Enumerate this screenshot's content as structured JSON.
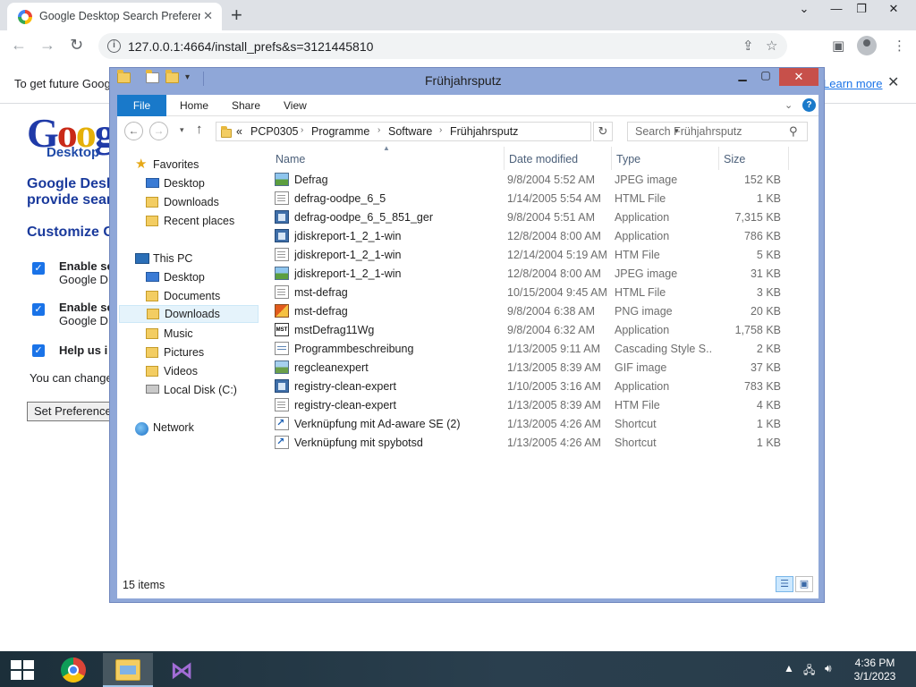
{
  "browser": {
    "tab_title": "Google Desktop Search Preferences",
    "tab_close": "✕",
    "new_tab": "+",
    "win_min": "⌄",
    "win_restore": "—",
    "win_max": "❐",
    "win_close": "✕",
    "url": "127.0.0.1:4664/install_prefs&s=3121445810",
    "info_text": "To get future Goog",
    "learn_more": "Learn more",
    "info_close": "✕",
    "icons": [
      "back-icon",
      "forward-icon",
      "reload-icon",
      "info-icon",
      "share-icon",
      "star-icon",
      "side-panel-icon",
      "profile-icon",
      "menu-icon"
    ]
  },
  "page": {
    "logo_letters": [
      "G",
      "o",
      "o",
      "g"
    ],
    "logo_sub": "Desktop",
    "heading1_line1": "Google Desk",
    "heading1_line2": "provide sear",
    "heading2": "Customize G",
    "options": [
      {
        "title": "Enable se",
        "sub": "Google D"
      },
      {
        "title": "Enable se",
        "sub": "Google D"
      },
      {
        "title": "Help us i",
        "sub": ""
      }
    ],
    "note": "You can change",
    "set_button": "Set Preferences"
  },
  "explorer": {
    "title": "Frühjahrsputz",
    "ribbon_tabs": [
      "File",
      "Home",
      "Share",
      "View"
    ],
    "breadcrumb": [
      "PCP0305",
      "Programme",
      "Software",
      "Frühjahrsputz"
    ],
    "breadcrumb_prefix": "«",
    "search_placeholder": "Search Frühjahrsputz",
    "nav": {
      "favorites": "Favorites",
      "fav_items": [
        "Desktop",
        "Downloads",
        "Recent places"
      ],
      "this_pc": "This PC",
      "pc_items": [
        "Desktop",
        "Documents",
        "Downloads",
        "Music",
        "Pictures",
        "Videos",
        "Local Disk (C:)"
      ],
      "network": "Network"
    },
    "columns": [
      "Name",
      "Date modified",
      "Type",
      "Size"
    ],
    "files": [
      {
        "name": "Defrag",
        "date": "9/8/2004 5:52 AM",
        "type": "JPEG image",
        "size": "152 KB",
        "icon": "jpeg"
      },
      {
        "name": "defrag-oodpe_6_5",
        "date": "1/14/2005 5:54 AM",
        "type": "HTML File",
        "size": "1 KB",
        "icon": "html"
      },
      {
        "name": "defrag-oodpe_6_5_851_ger",
        "date": "9/8/2004 5:51 AM",
        "type": "Application",
        "size": "7,315 KB",
        "icon": "app"
      },
      {
        "name": "jdiskreport-1_2_1-win",
        "date": "12/8/2004 8:00 AM",
        "type": "Application",
        "size": "786 KB",
        "icon": "app"
      },
      {
        "name": "jdiskreport-1_2_1-win",
        "date": "12/14/2004 5:19 AM",
        "type": "HTM File",
        "size": "5 KB",
        "icon": "html"
      },
      {
        "name": "jdiskreport-1_2_1-win",
        "date": "12/8/2004 8:00 AM",
        "type": "JPEG image",
        "size": "31 KB",
        "icon": "jpeg"
      },
      {
        "name": "mst-defrag",
        "date": "10/15/2004 9:45 AM",
        "type": "HTML File",
        "size": "3 KB",
        "icon": "html"
      },
      {
        "name": "mst-defrag",
        "date": "9/8/2004 6:38 AM",
        "type": "PNG image",
        "size": "20 KB",
        "icon": "png"
      },
      {
        "name": "mstDefrag11Wg",
        "date": "9/8/2004 6:32 AM",
        "type": "Application",
        "size": "1,758 KB",
        "icon": "mst"
      },
      {
        "name": "Programmbeschreibung",
        "date": "1/13/2005 9:11 AM",
        "type": "Cascading Style S...",
        "size": "2 KB",
        "icon": "css"
      },
      {
        "name": "regcleanexpert",
        "date": "1/13/2005 8:39 AM",
        "type": "GIF image",
        "size": "37 KB",
        "icon": "gif"
      },
      {
        "name": "registry-clean-expert",
        "date": "1/10/2005 3:16 AM",
        "type": "Application",
        "size": "783 KB",
        "icon": "app"
      },
      {
        "name": "registry-clean-expert",
        "date": "1/13/2005 8:39 AM",
        "type": "HTM File",
        "size": "4 KB",
        "icon": "html"
      },
      {
        "name": "Verknüpfung mit Ad-aware SE  (2)",
        "date": "1/13/2005 4:26 AM",
        "type": "Shortcut",
        "size": "1 KB",
        "icon": "lnk"
      },
      {
        "name": "Verknüpfung mit spybotsd",
        "date": "1/13/2005 4:26 AM",
        "type": "Shortcut",
        "size": "1 KB",
        "icon": "lnk"
      }
    ],
    "status": "15 items"
  },
  "taskbar": {
    "clock_time": "4:36 PM",
    "clock_date": "3/1/2023",
    "apps": [
      "chrome-icon",
      "file-explorer-icon",
      "visual-studio-icon"
    ]
  },
  "colors": {
    "explorer_frame": "#8fa7d8",
    "ribbon_file": "#1979ca",
    "close_red": "#c7504a",
    "page_heading": "#1a3a9c"
  }
}
